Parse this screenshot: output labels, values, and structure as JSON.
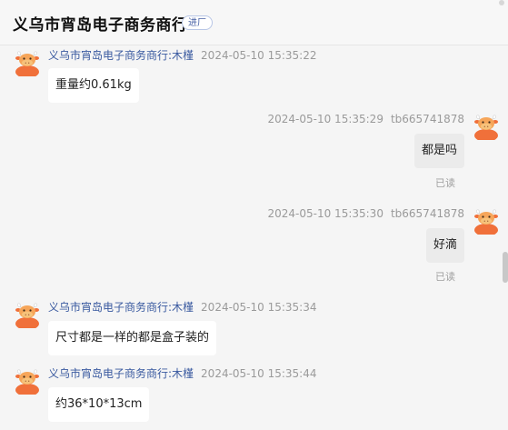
{
  "header": {
    "shop_name": "义乌市宵岛电子商务商行",
    "badge": "进厂"
  },
  "messages": [
    {
      "side": "left",
      "sender": "义乌市宵岛电子商务商行:木槿",
      "time": "2024-05-10 15:35:22",
      "text": "重量约0.61kg"
    },
    {
      "side": "right",
      "sender": "tb665741878",
      "time": "2024-05-10 15:35:29",
      "text": "都是吗",
      "status": "已读"
    },
    {
      "side": "right",
      "sender": "tb665741878",
      "time": "2024-05-10 15:35:30",
      "text": "好滴",
      "status": "已读"
    },
    {
      "side": "left",
      "sender": "义乌市宵岛电子商务商行:木槿",
      "time": "2024-05-10 15:35:34",
      "text": "尺寸都是一样的都是盒子装的"
    },
    {
      "side": "left",
      "sender": "义乌市宵岛电子商务商行:木槿",
      "time": "2024-05-10 15:35:44",
      "text": "约36*10*13cm"
    }
  ],
  "icons": {
    "avatar": "cartoon-cow-avatar-icon"
  },
  "colors": {
    "accent": "#3a5aa0",
    "avatar_orange": "#f0703a",
    "avatar_face": "#f6c27a"
  }
}
